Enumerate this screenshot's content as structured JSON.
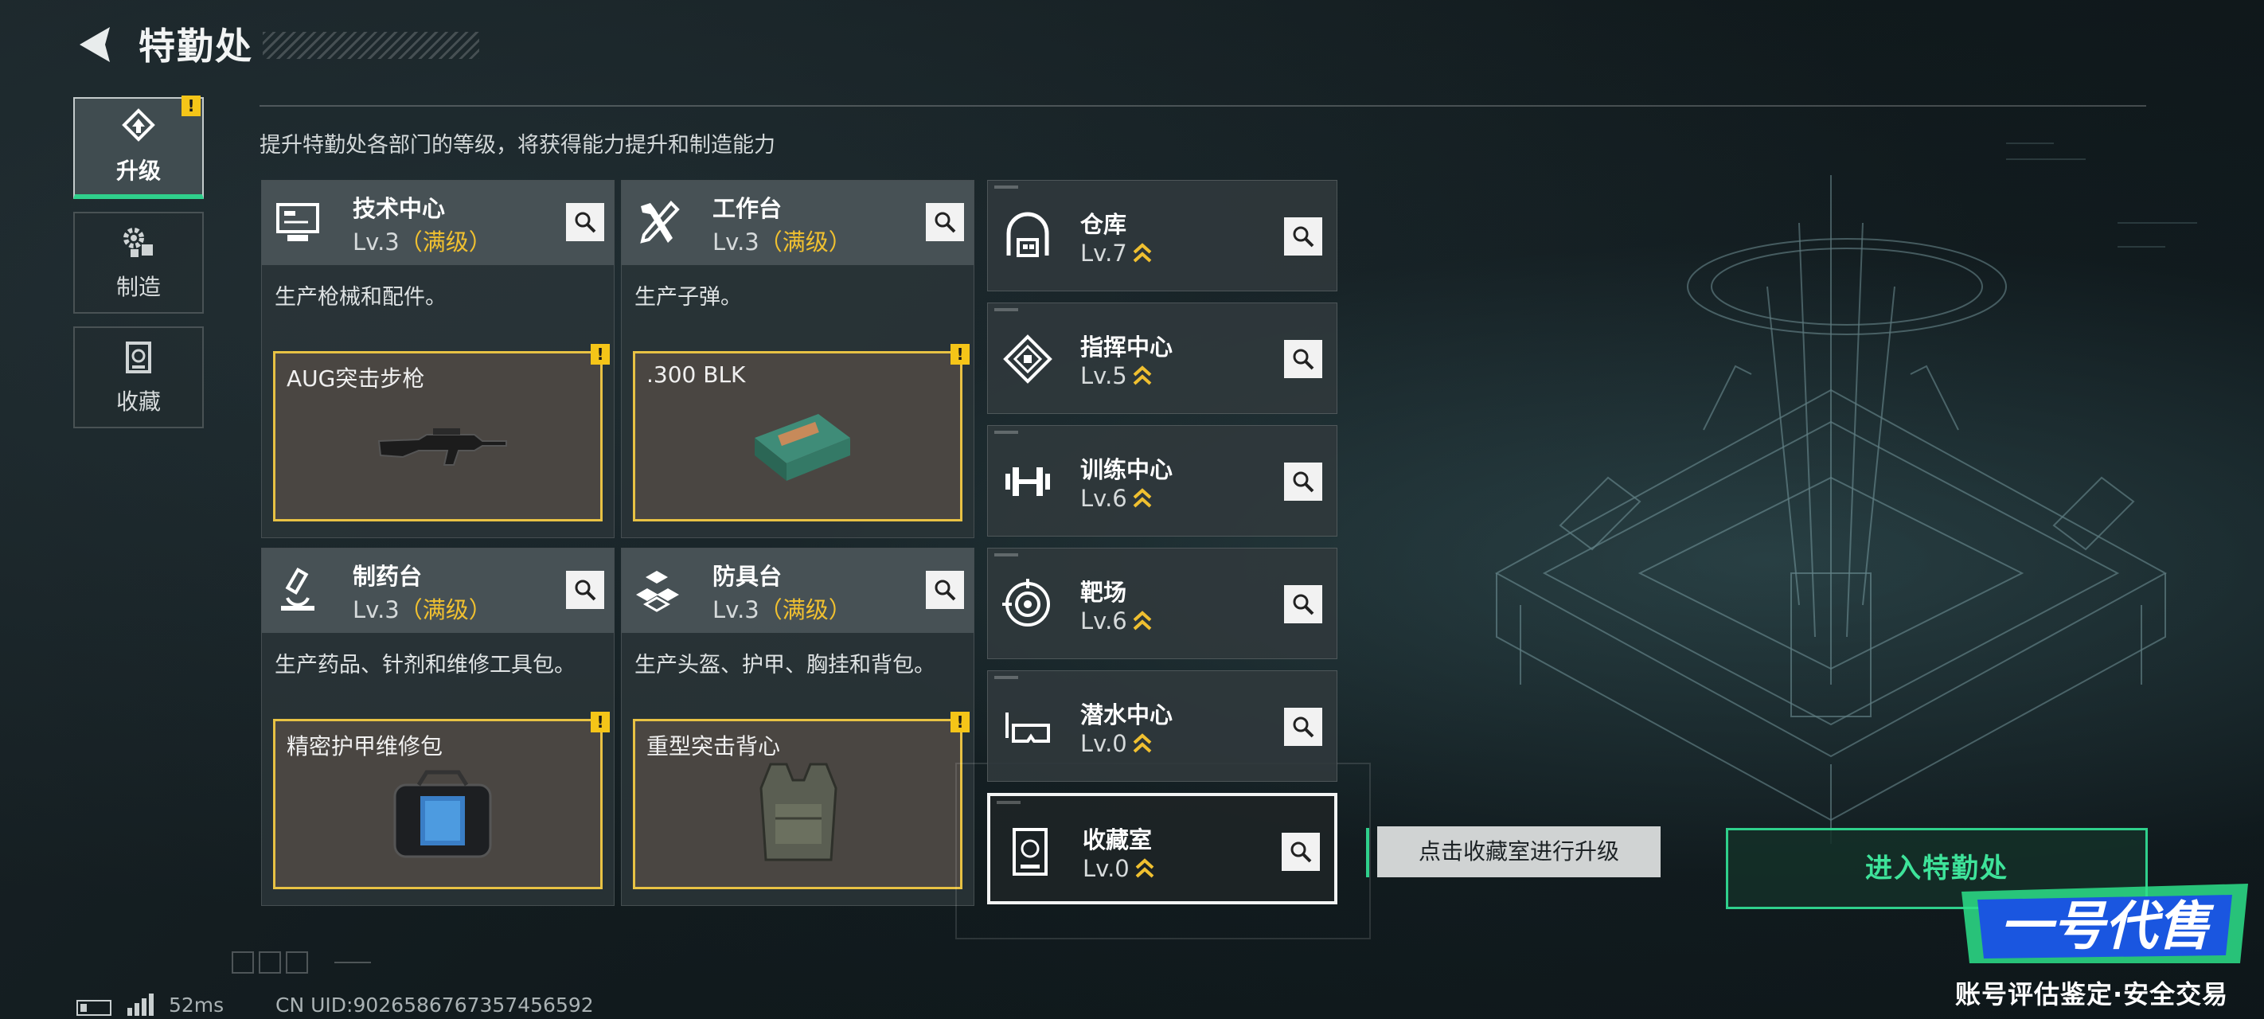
{
  "header": {
    "title": "特勤处"
  },
  "tabs": [
    {
      "label": "升级",
      "icon": "upgrade-icon",
      "active": true,
      "alert": "!"
    },
    {
      "label": "制造",
      "icon": "gears-icon",
      "active": false
    },
    {
      "label": "收藏",
      "icon": "collection-icon",
      "active": false
    }
  ],
  "subtitle": "提升特勤处各部门的等级，将获得能力提升和制造能力",
  "departments": [
    {
      "name": "技术中心",
      "level": "Lv.3",
      "max_tag": "（满级）",
      "desc": "生产枪械和配件。",
      "item": "AUG突击步枪",
      "alert": "!",
      "icon": "computer-icon"
    },
    {
      "name": "工作台",
      "level": "Lv.3",
      "max_tag": "（满级）",
      "desc": "生产子弹。",
      "item": ".300 BLK",
      "alert": "!",
      "icon": "tools-icon"
    },
    {
      "name": "制药台",
      "level": "Lv.3",
      "max_tag": "（满级）",
      "desc": "生产药品、针剂和维修工具包。",
      "item": "精密护甲维修包",
      "alert": "!",
      "icon": "microscope-icon"
    },
    {
      "name": "防具台",
      "level": "Lv.3",
      "max_tag": "（满级）",
      "desc": "生产头盔、护甲、胸挂和背包。",
      "item": "重型突击背心",
      "alert": "!",
      "icon": "armor-blocks-icon"
    }
  ],
  "facilities": [
    {
      "name": "仓库",
      "level": "Lv.7",
      "icon": "warehouse-icon"
    },
    {
      "name": "指挥中心",
      "level": "Lv.5",
      "icon": "command-icon"
    },
    {
      "name": "训练中心",
      "level": "Lv.6",
      "icon": "dumbbell-icon"
    },
    {
      "name": "靶场",
      "level": "Lv.6",
      "icon": "target-icon"
    },
    {
      "name": "潜水中心",
      "level": "Lv.0",
      "icon": "diving-mask-icon"
    },
    {
      "name": "收藏室",
      "level": "Lv.0",
      "icon": "collection-room-icon",
      "selected": true
    }
  ],
  "tooltip": "点击收藏室进行升级",
  "enter_button": "进入特勤处",
  "status": {
    "ping": "52ms",
    "uid": "CN UID:9026586767357456592"
  },
  "watermark": {
    "logo": "一号代售",
    "tagline": "账号评估鉴定·安全交易"
  },
  "colors": {
    "accent_green": "#2fd08c",
    "max_level_gold": "#f0c030",
    "alert_yellow": "#f5c518"
  }
}
